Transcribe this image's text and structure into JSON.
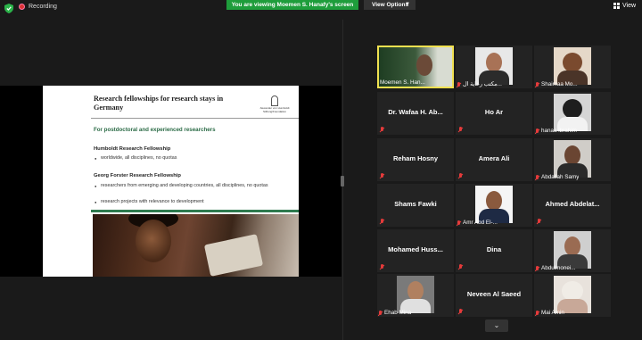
{
  "topbar": {
    "recording_label": "Recording",
    "viewing_banner": "You are viewing Moemen S. Hanafy's screen",
    "view_options_label": "View Options",
    "view_label": "View"
  },
  "slide": {
    "title": "Research fellowships for research stays in Germany",
    "logo_text": "Alexander von Humboldt Stiftung/Foundation",
    "subtitle": "For postdoctoral and experienced researchers",
    "sections": [
      {
        "heading": "Humboldt Research Fellowship",
        "bullets": [
          "worldwide, all disciplines, no quotas"
        ]
      },
      {
        "heading": "Georg Forster Research Fellowship",
        "bullets": [
          "researchers from emerging and developing countries, all disciplines, no quotas",
          "research projects with relevance to development"
        ]
      }
    ]
  },
  "participants": [
    {
      "name": "Moemen S. Han..."
    },
    {
      "name": "مكتب رعاية ال..."
    },
    {
      "name": "Shaimaa Mo..."
    },
    {
      "name": "Dr. Wafaa H. Ab..."
    },
    {
      "name": "Ho Ar"
    },
    {
      "name": "hanaa ibrahim"
    },
    {
      "name": "Reham Hosny"
    },
    {
      "name": "Amera Ali"
    },
    {
      "name": "Abdallah Samy"
    },
    {
      "name": "Shams Fawki"
    },
    {
      "name": "Amr Abd El-..."
    },
    {
      "name": "Ahmed  Abdelat..."
    },
    {
      "name": "Mohamed  Huss..."
    },
    {
      "name": "Dina"
    },
    {
      "name": "Abdulmonei..."
    },
    {
      "name": "Ehab Mina"
    },
    {
      "name": "Neveen Al Saeed"
    },
    {
      "name": "Mai Amin"
    }
  ],
  "colors": {
    "banner": "#1e9d3b",
    "active_speaker": "#f0e050",
    "muted": "#e53b3b"
  }
}
